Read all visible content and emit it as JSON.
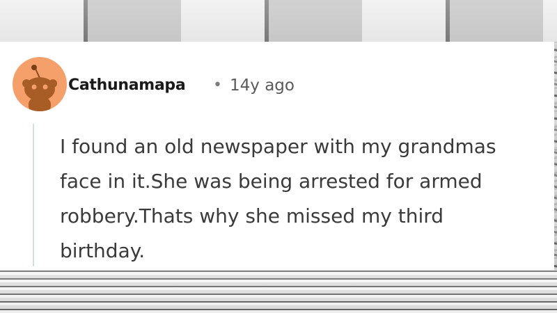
{
  "post": {
    "username": "Cathunamapa",
    "separator": "•",
    "timestamp": "14y ago",
    "avatar_icon": "reddit-snoo-avatar-icon",
    "avatar_color": "#f5a06b",
    "comment_lines": [
      "I found an old newspaper with my grandmas",
      "face in it.She was being arrested for armed",
      "robbery.Thats why she missed my third",
      "birthday."
    ]
  }
}
